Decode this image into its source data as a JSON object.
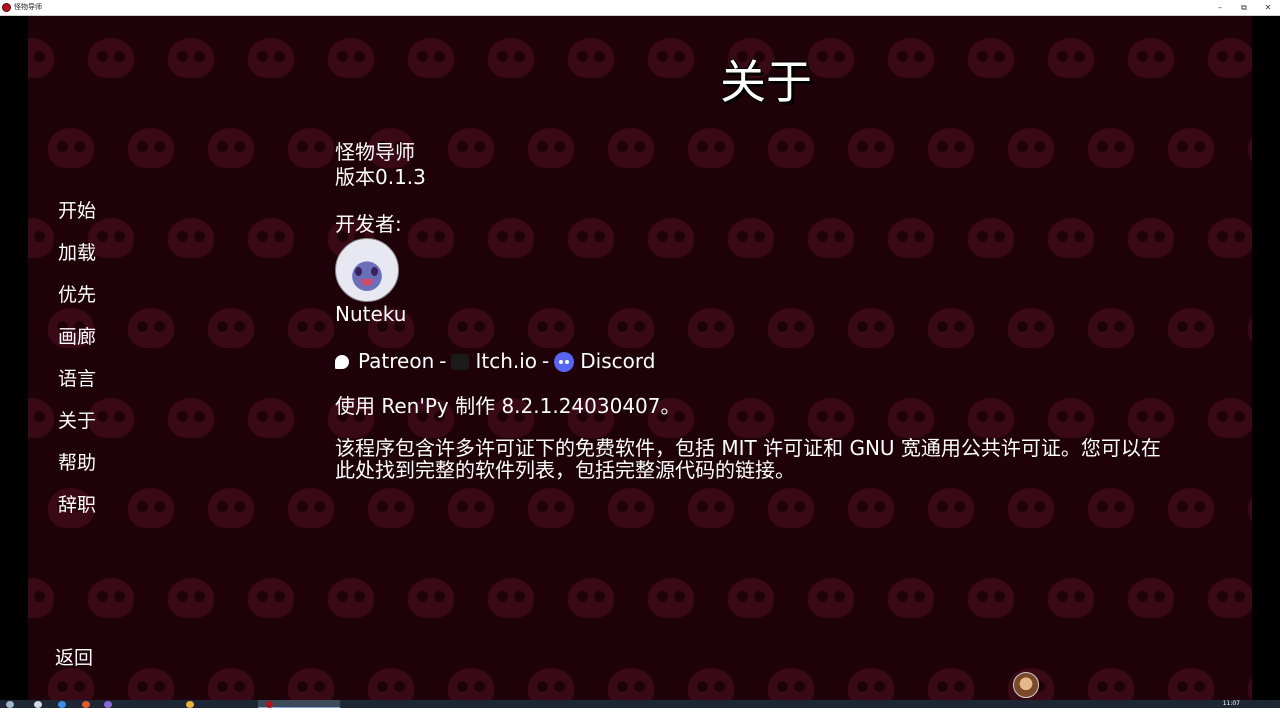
{
  "window": {
    "title": "怪物导师",
    "controls": {
      "minimize": "–",
      "restore": "⧉",
      "close": "✕"
    }
  },
  "screen": {
    "title": "关于",
    "nav": [
      {
        "label": "开始"
      },
      {
        "label": "加载"
      },
      {
        "label": "优先"
      },
      {
        "label": "画廊"
      },
      {
        "label": "语言"
      },
      {
        "label": "关于"
      },
      {
        "label": "帮助"
      },
      {
        "label": "辞职"
      }
    ],
    "back_label": "返回"
  },
  "about": {
    "game_name": "怪物导师",
    "version": "版本0.1.3",
    "developer_label": "开发者:",
    "developer_name": "Nuteku",
    "links": {
      "patreon": "Patreon",
      "itch": "Itch.io",
      "discord": "Discord",
      "separator": "-"
    },
    "made_with": "使用 Ren'Py 制作 8.2.1.24030407。",
    "license_line1": "该程序包含许多许可证下的免费软件，包括 MIT 许可证和 GNU 宽通用公共许可证。您可以在",
    "license_line2": "此处找到完整的软件列表，包括完整源代码的链接。"
  },
  "taskbar": {
    "clock": "11:07"
  },
  "colors": {
    "background": "#1f0209",
    "pattern": "#3a0916",
    "text": "#ffffff",
    "discord": "#5865f2"
  }
}
